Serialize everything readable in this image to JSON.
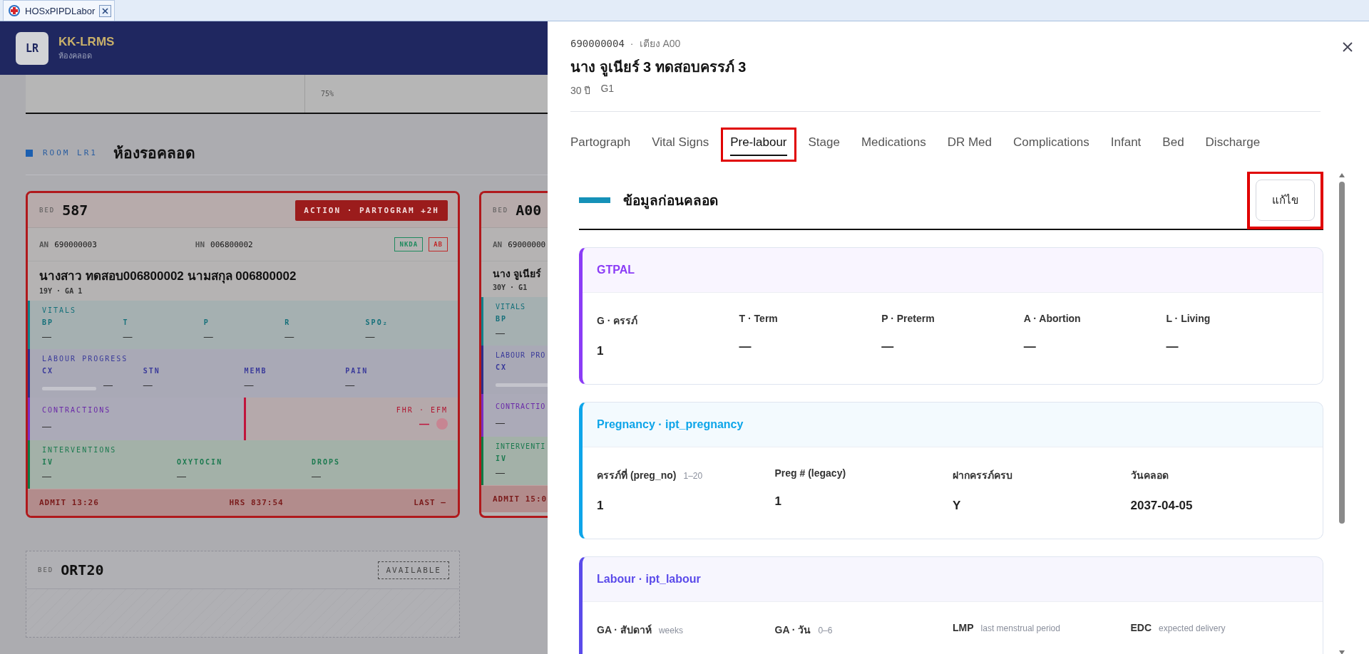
{
  "browser_tab": {
    "title": "HOSxPIPDLabor"
  },
  "app_header": {
    "logo": "LR",
    "title": "KK-LRMS",
    "subtitle": "ห้องคลอด"
  },
  "summary_strip": {
    "value": "75%"
  },
  "room": {
    "label": "ROOM LR1",
    "name": "ห้องรอคลอด"
  },
  "beds": [
    {
      "kind": "occupied",
      "bed_label": "BED",
      "bed": "587",
      "alert": "ACTION · PARTOGRAM +2H",
      "an_label": "AN",
      "an": "690000003",
      "hn_label": "HN",
      "hn": "006800002",
      "tags": [
        {
          "text": "NKDA",
          "color": "#1f8a5e"
        },
        {
          "text": "AB",
          "color": "#c02a2a"
        }
      ],
      "name": "นางสาว ทดสอบ006800002 นามสกุล 006800002",
      "sub": "19Y · GA 1",
      "sections": [
        {
          "kind": "vitals",
          "title": "VITALS",
          "fields": [
            {
              "label": "BP",
              "value": "—"
            },
            {
              "label": "T",
              "value": "—"
            },
            {
              "label": "P",
              "value": "—"
            },
            {
              "label": "R",
              "value": "—"
            },
            {
              "label": "SPO₂",
              "value": "—"
            }
          ]
        },
        {
          "kind": "labour",
          "title": "LABOUR PROGRESS",
          "fields": [
            {
              "label": "CX",
              "value": "—",
              "level": 0
            },
            {
              "label": "STN",
              "value": "—"
            },
            {
              "label": "MEMB",
              "value": "—"
            },
            {
              "label": "PAIN",
              "value": "—"
            }
          ]
        },
        {
          "kind": "contractions",
          "title": "CONTRACTIONS",
          "value": "—",
          "side_title": "FHR · EFM",
          "side_value": "—"
        },
        {
          "kind": "interventions",
          "title": "INTERVENTIONS",
          "fields": [
            {
              "label": "IV",
              "value": "—"
            },
            {
              "label": "OXYTOCIN",
              "value": "—"
            },
            {
              "label": "DROPS",
              "value": "—"
            }
          ]
        }
      ],
      "footer": [
        {
          "label": "ADMIT",
          "value": "13:26"
        },
        {
          "label": "HRS",
          "value": "837:54"
        },
        {
          "label": "LAST",
          "value": "—"
        }
      ]
    },
    {
      "kind": "partial",
      "bed_label": "BED",
      "bed": "A00",
      "an_label": "AN",
      "an": "69000000",
      "name": "นาง จูเนียร์",
      "sub": "30Y · G1",
      "sections": [
        {
          "kind": "vitals",
          "title": "VITALS",
          "fields": [
            {
              "label": "BP",
              "value": "—"
            }
          ]
        },
        {
          "kind": "labour",
          "title": "LABOUR PRO",
          "fields": [
            {
              "label": "CX",
              "level": 0
            }
          ]
        },
        {
          "kind": "contractions",
          "title": "CONTRACTIO",
          "value": "—"
        },
        {
          "kind": "interventions",
          "title": "INTERVENTI",
          "fields": [
            {
              "label": "IV",
              "value": "—"
            }
          ]
        }
      ],
      "footer": [
        {
          "label": "ADMIT",
          "value": "15:0"
        }
      ]
    },
    {
      "kind": "available",
      "bed_label": "BED",
      "bed": "ORT20",
      "status": "AVAILABLE"
    }
  ],
  "drawer": {
    "id": "690000004",
    "separator": "·",
    "bed": "เตียง A00",
    "name": "นาง จูเนียร์ 3 ทดสอบครรภ์ 3",
    "age": "30 ปี",
    "gravida": "G1",
    "tabs": [
      {
        "label": "Partograph",
        "selected": false,
        "highlighted": false
      },
      {
        "label": "Vital Signs",
        "selected": false,
        "highlighted": false
      },
      {
        "label": "Pre-labour",
        "selected": true,
        "highlighted": true
      },
      {
        "label": "Stage",
        "selected": false,
        "highlighted": false
      },
      {
        "label": "Medications",
        "selected": false,
        "highlighted": false
      },
      {
        "label": "DR Med",
        "selected": false,
        "highlighted": false
      },
      {
        "label": "Complications",
        "selected": false,
        "highlighted": false
      },
      {
        "label": "Infant",
        "selected": false,
        "highlighted": false
      },
      {
        "label": "Bed",
        "selected": false,
        "highlighted": false
      },
      {
        "label": "Discharge",
        "selected": false,
        "highlighted": false
      }
    ],
    "section": {
      "title": "ข้อมูลก่อนคลอด",
      "edit_button": {
        "label": "แก้ไข",
        "highlighted": true
      }
    },
    "cards": [
      {
        "title": "GTPAL",
        "color": "#8b3cf6",
        "fields": [
          {
            "label": "G · ครรภ์",
            "value": "1"
          },
          {
            "label": "T · Term",
            "value": "—"
          },
          {
            "label": "P · Preterm",
            "value": "—"
          },
          {
            "label": "A · Abortion",
            "value": "—"
          },
          {
            "label": "L · Living",
            "value": "—"
          }
        ]
      },
      {
        "title": "Pregnancy · ipt_pregnancy",
        "color": "#0ea5e9",
        "fields": [
          {
            "label": "ครรภ์ที่ (preg_no)",
            "hint": "1–20",
            "value": "1"
          },
          {
            "label": "Preg # (legacy)",
            "value": "1"
          },
          {
            "label": "ฝากครรภ์ครบ",
            "value": "Y"
          },
          {
            "label": "วันคลอด",
            "value": "2037-04-05"
          }
        ]
      },
      {
        "title": "Labour · ipt_labour",
        "color": "#5b4bea",
        "fields": [
          {
            "label": "GA · สัปดาห์",
            "hint": "weeks"
          },
          {
            "label": "GA · วัน",
            "hint": "0–6"
          },
          {
            "label": "LMP",
            "hint": "last menstrual period"
          },
          {
            "label": "EDC",
            "hint": "expected delivery"
          }
        ]
      }
    ]
  }
}
